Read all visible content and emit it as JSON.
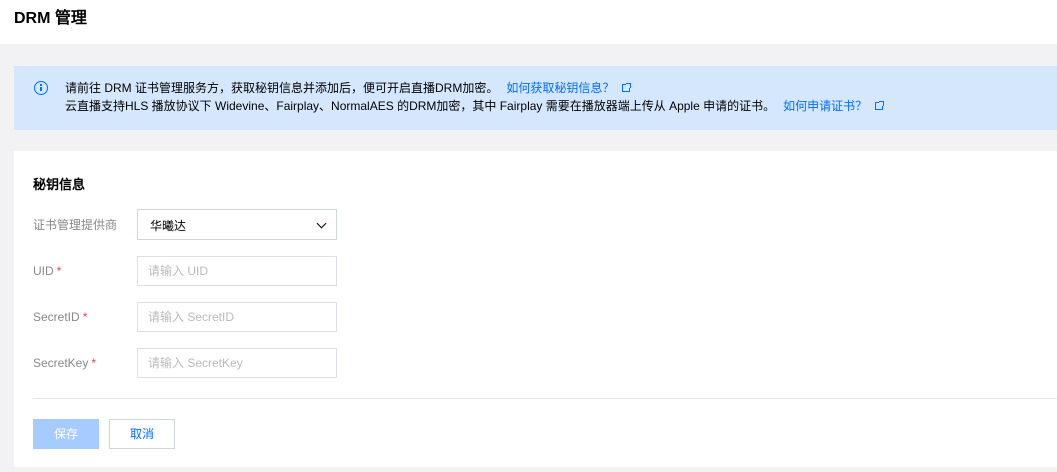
{
  "header": {
    "title": "DRM 管理"
  },
  "notice": {
    "line1_text": "请前往 DRM 证书管理服务方，获取秘钥信息并添加后，便可开启直播DRM加密。",
    "line1_link": "如何获取秘钥信息？",
    "line2_text": "云直播支持HLS 播放协议下 Widevine、Fairplay、NormalAES 的DRM加密，其中 Fairplay 需要在播放器端上传从 Apple 申请的证书。",
    "line2_link": "如何申请证书？"
  },
  "form": {
    "section_title": "秘钥信息",
    "provider": {
      "label": "证书管理提供商",
      "value": "华曦达"
    },
    "uid": {
      "label": "UID",
      "placeholder": "请输入 UID"
    },
    "secret_id": {
      "label": "SecretID",
      "placeholder": "请输入 SecretID"
    },
    "secret_key": {
      "label": "SecretKey",
      "placeholder": "请输入 SecretKey"
    },
    "required_mark": "*"
  },
  "actions": {
    "save_label": "保存",
    "cancel_label": "取消"
  },
  "colors": {
    "accent": "#006eff",
    "notice_bg": "#d5e7fd",
    "required": "#e54545",
    "save_disabled": "#a6cbfe"
  }
}
